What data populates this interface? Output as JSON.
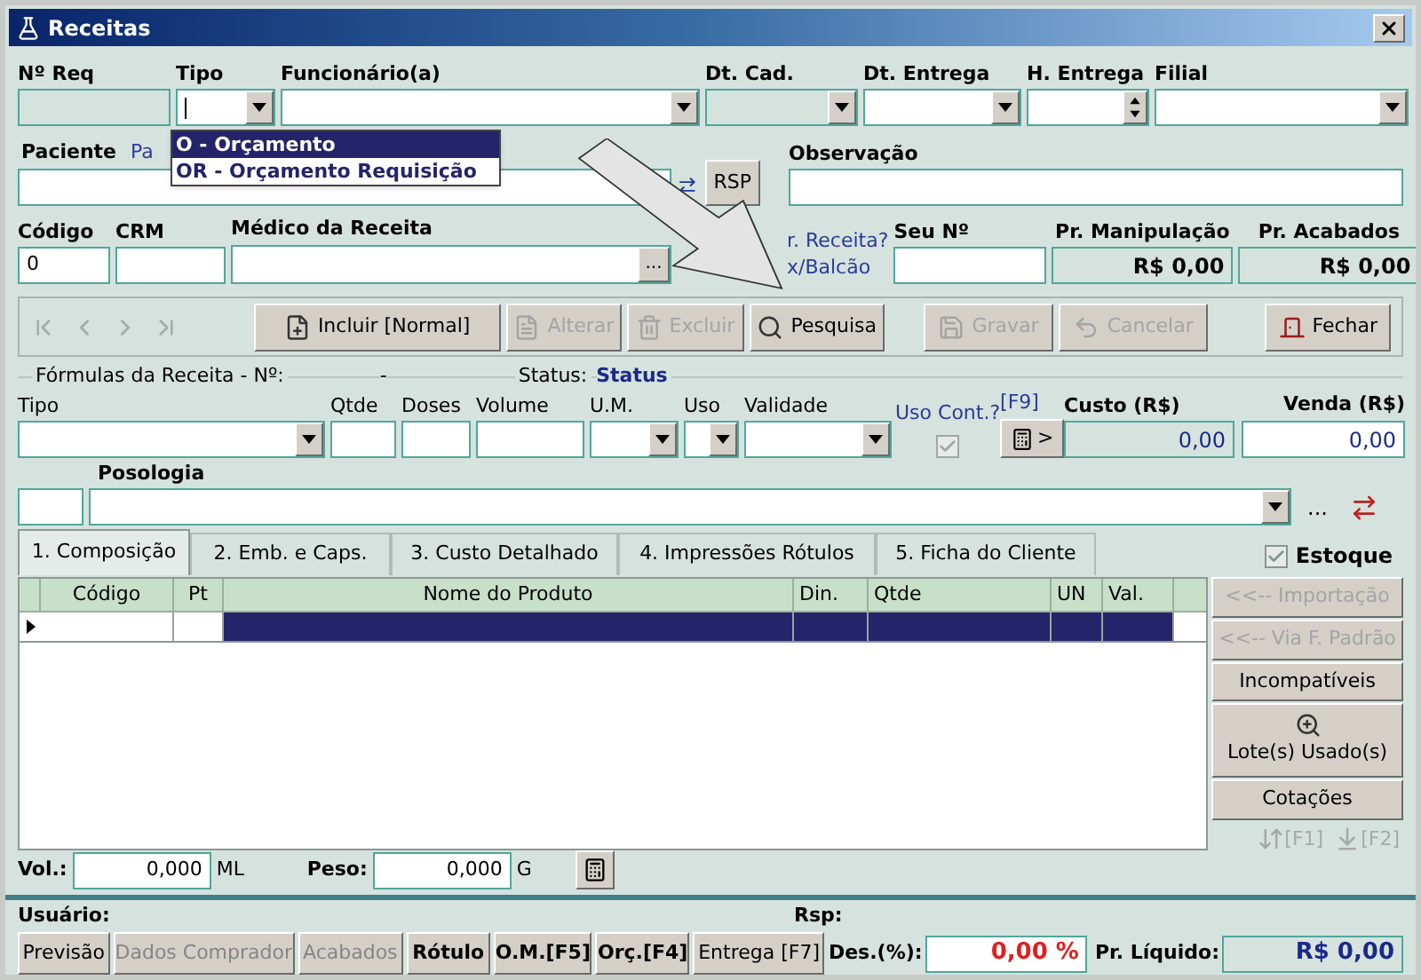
{
  "window": {
    "title": "Receitas"
  },
  "row1": [
    {
      "label": "Nº Req",
      "kind": "readonly"
    },
    {
      "label": "Tipo",
      "kind": "combo"
    },
    {
      "label": "Funcionário(a)",
      "kind": "combo"
    },
    {
      "label": "Dt. Cad.",
      "kind": "readonly-combo"
    },
    {
      "label": "Dt. Entrega",
      "kind": "combo"
    },
    {
      "label": "H. Entrega",
      "kind": "spin"
    },
    {
      "label": "Filial",
      "kind": "combo"
    }
  ],
  "tipo_dropdown": [
    {
      "label": "O - Orçamento",
      "selected": true
    },
    {
      "label": "OR - Orçamento Requisição",
      "selected": false
    }
  ],
  "paciente": {
    "label": "Paciente",
    "link": "Pa"
  },
  "rsp_button": "RSP",
  "observacao": {
    "label": "Observação"
  },
  "codigo": {
    "label": "Código",
    "value": "0"
  },
  "crm": {
    "label": "CRM"
  },
  "medico": {
    "label": "Médico da Receita",
    "button": "..."
  },
  "receita_hint": [
    "r. Receita?",
    "x/Balcão"
  ],
  "seu_numero": {
    "label": "Seu Nº"
  },
  "prices": [
    {
      "label": "Pr. Manipulação",
      "value": "R$ 0,00"
    },
    {
      "label": "Pr. Acabados",
      "value": "R$ 0,00"
    }
  ],
  "nav_disabled": true,
  "toolbar": [
    {
      "label": "Incluir [Normal]",
      "disabled": false
    },
    {
      "label": "Alterar",
      "disabled": true
    },
    {
      "label": "Excluir",
      "disabled": true
    },
    {
      "label": "Pesquisa",
      "disabled": false
    },
    {
      "label": "Gravar",
      "disabled": true
    },
    {
      "label": "Cancelar",
      "disabled": true
    },
    {
      "label": "Fechar",
      "disabled": false
    }
  ],
  "formula": {
    "title": "Fórmulas da Receita - Nº:",
    "number": "-",
    "status_label": "Status:",
    "status": "Status"
  },
  "formula_fields": [
    {
      "label": "Tipo",
      "kind": "combo"
    },
    {
      "label": "Qtde",
      "kind": "text"
    },
    {
      "label": "Doses",
      "kind": "text"
    },
    {
      "label": "Volume",
      "kind": "text"
    },
    {
      "label": "U.M.",
      "kind": "combo"
    },
    {
      "label": "Uso",
      "kind": "combo"
    },
    {
      "label": "Validade",
      "kind": "combo"
    }
  ],
  "uso_cont": {
    "label": "Uso Cont.?",
    "checked": true,
    "disabled": true
  },
  "f9": "[F9]",
  "calc_arrow": ">",
  "custo": {
    "label": "Custo (R$)",
    "value": "0,00"
  },
  "venda": {
    "label": "Venda (R$)",
    "value": "0,00"
  },
  "posologia": {
    "label": "Posologia",
    "more": "..."
  },
  "tabs": [
    {
      "label": "1. Composição",
      "selected": true
    },
    {
      "label": "2. Emb. e Caps.",
      "selected": false
    },
    {
      "label": "3. Custo Detalhado",
      "selected": false
    },
    {
      "label": "4. Impressões Rótulos",
      "selected": false
    },
    {
      "label": "5. Ficha do Cliente",
      "selected": false
    }
  ],
  "estoque": {
    "label": "Estoque",
    "checked": true
  },
  "grid": {
    "columns": [
      "Código",
      "Pt",
      "Nome do Produto",
      "Din.",
      "Qtde",
      "UN",
      "Val."
    ],
    "rows": [
      {
        "selected": true
      }
    ]
  },
  "side_buttons": [
    {
      "label": "<<-- Importação",
      "disabled": true
    },
    {
      "label": "<<-- Via F. Padrão",
      "disabled": true
    },
    {
      "label": "Incompatíveis",
      "disabled": false
    },
    {
      "label": "Lote(s) Usado(s)",
      "disabled": false
    },
    {
      "label": "Cotações",
      "disabled": false
    }
  ],
  "f_keys": [
    {
      "label": "[F1]",
      "disabled": true
    },
    {
      "label": "[F2]",
      "disabled": true
    }
  ],
  "vol": {
    "label": "Vol.:",
    "value": "0,000",
    "unit": "ML"
  },
  "peso": {
    "label": "Peso:",
    "value": "0,000",
    "unit": "G"
  },
  "usuario": "Usuário:",
  "rsp": "Rsp:",
  "footer_buttons": [
    {
      "label": "Previsão",
      "disabled": false,
      "bold": false
    },
    {
      "label": "Dados Comprador",
      "disabled": true,
      "bold": false
    },
    {
      "label": "Acabados",
      "disabled": true,
      "bold": false
    },
    {
      "label": "Rótulo",
      "disabled": false,
      "bold": true
    },
    {
      "label": "O.M.[F5]",
      "disabled": false,
      "bold": true
    },
    {
      "label": "Orç.[F4]",
      "disabled": false,
      "bold": true
    },
    {
      "label": "Entrega [F7]",
      "disabled": false,
      "bold": false
    }
  ],
  "desconto": {
    "label": "Des.(%):",
    "value": "0,00 %"
  },
  "liquido": {
    "label": "Pr. Líquido:",
    "value": "R$ 0,00"
  }
}
